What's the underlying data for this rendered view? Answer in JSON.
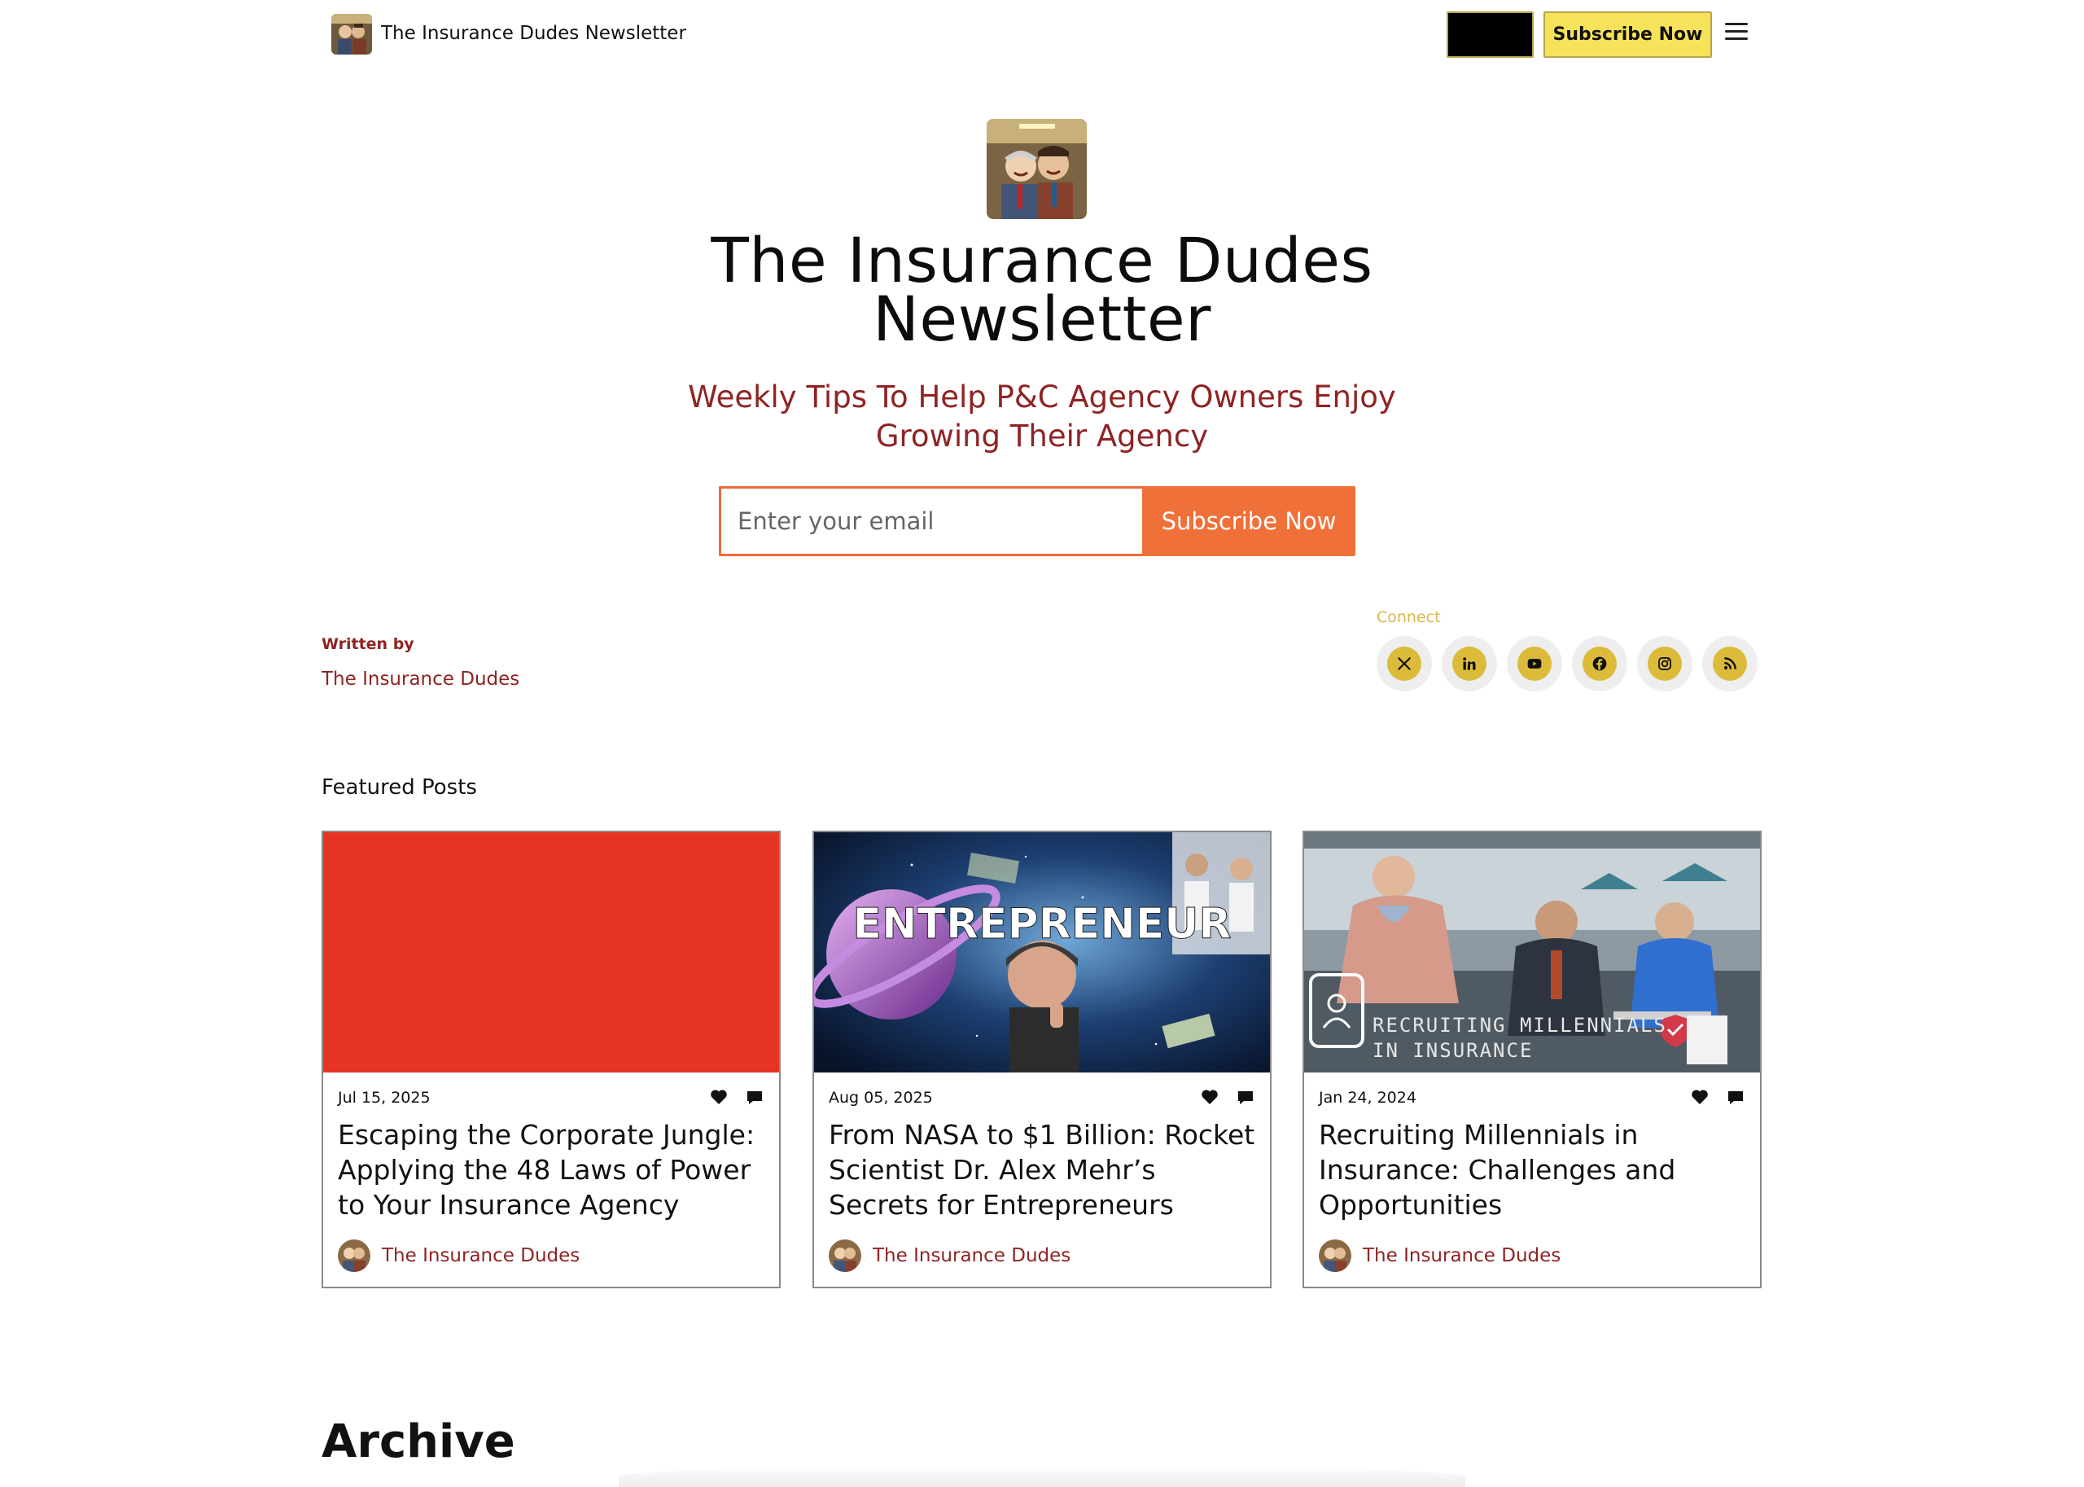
{
  "nav": {
    "title": "The Insurance Dudes Newsletter",
    "subscribe_label": "Subscribe Now",
    "logo_icon": "dudes-caricature-logo",
    "menu_icon": "hamburger-menu-icon"
  },
  "hero": {
    "title": "The Insurance Dudes Newsletter",
    "subtitle": "Weekly Tips To Help P&C Agency Owners Enjoy Growing Their Agency",
    "email_placeholder": "Enter your email",
    "subscribe_label": "Subscribe Now"
  },
  "author": {
    "written_by_label": "Written by",
    "name": "The Insurance Dudes"
  },
  "connect": {
    "label": "Connect",
    "socials": [
      "x-icon",
      "linkedin-icon",
      "youtube-icon",
      "facebook-icon",
      "instagram-icon",
      "rss-icon"
    ]
  },
  "featured": {
    "heading": "Featured Posts",
    "posts": [
      {
        "date": "Jul 15, 2025",
        "title": "Escaping the Corporate Jungle: Applying the 48 Laws of Power to Your Insurance Agency",
        "author": "The Insurance Dudes",
        "image_color": "#e63323"
      },
      {
        "date": "Aug 05, 2025",
        "title": "From NASA to $1 Billion: Rocket Scientist Dr. Alex Mehr’s Secrets for Entrepreneurs",
        "author": "The Insurance Dudes",
        "image_text": "ENTREPRENEUR"
      },
      {
        "date": "Jan 24, 2024",
        "title": "Recruiting Millennials in Insurance: Challenges and Opportunities",
        "author": "The Insurance Dudes",
        "image_text_line1": "RECRUITING MILLENNIALS",
        "image_text_line2": "IN INSURANCE"
      }
    ]
  },
  "archive": {
    "heading": "Archive"
  },
  "colors": {
    "accent_orange": "#f0703a",
    "accent_yellow": "#f7e35a",
    "maroon_text": "#8f2323",
    "social_gold": "#dcbb3b"
  }
}
